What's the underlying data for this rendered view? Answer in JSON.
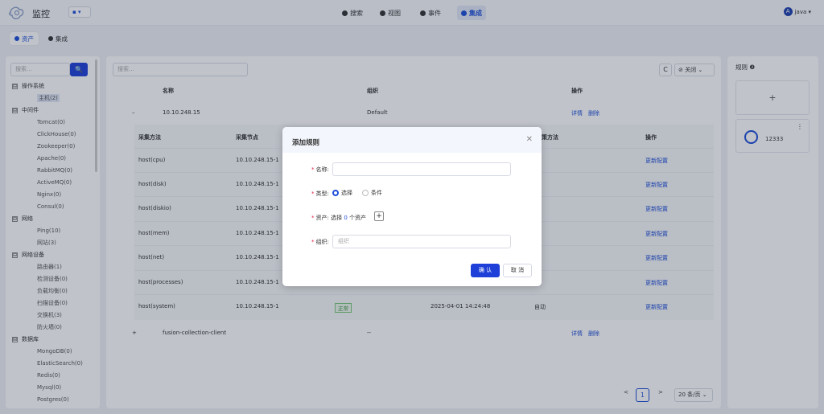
{
  "app": {
    "title": "监控",
    "selector": "▾"
  },
  "nav": [
    {
      "label": "搜索"
    },
    {
      "label": "视图"
    },
    {
      "label": "事件"
    },
    {
      "label": "集成"
    }
  ],
  "user": {
    "avatar": "A",
    "name": "java ▾"
  },
  "subtabs": [
    {
      "label": "资产"
    },
    {
      "label": "集成"
    }
  ],
  "left": {
    "search_placeholder": "搜索...",
    "search_btn": "🔍",
    "tree": [
      {
        "type": "grp",
        "label": "操作系统",
        "box": "⊟"
      },
      {
        "type": "child",
        "label": "主机(2)",
        "selected": true
      },
      {
        "type": "grp",
        "label": "中间件",
        "box": "⊟"
      },
      {
        "type": "child",
        "label": "Tomcat(0)"
      },
      {
        "type": "child",
        "label": "ClickHouse(0)"
      },
      {
        "type": "child",
        "label": "Zookeeper(0)"
      },
      {
        "type": "child",
        "label": "Apache(0)"
      },
      {
        "type": "child",
        "label": "RabbitMQ(0)"
      },
      {
        "type": "child",
        "label": "ActiveMQ(0)"
      },
      {
        "type": "child",
        "label": "Nginx(0)"
      },
      {
        "type": "child",
        "label": "Consul(0)"
      },
      {
        "type": "grp",
        "label": "网络",
        "box": "⊟"
      },
      {
        "type": "child",
        "label": "Ping(10)"
      },
      {
        "type": "child",
        "label": "网站(3)"
      },
      {
        "type": "grp",
        "label": "网络设备",
        "box": "⊟"
      },
      {
        "type": "child",
        "label": "路由器(1)"
      },
      {
        "type": "child",
        "label": "检测设备(0)"
      },
      {
        "type": "child",
        "label": "负载均衡(0)"
      },
      {
        "type": "child",
        "label": "扫描设备(0)"
      },
      {
        "type": "child",
        "label": "交换机(3)"
      },
      {
        "type": "child",
        "label": "防火墙(0)"
      },
      {
        "type": "grp",
        "label": "数据库",
        "box": "⊟"
      },
      {
        "type": "child",
        "label": "MongoDB(0)"
      },
      {
        "type": "child",
        "label": "ElasticSearch(0)"
      },
      {
        "type": "child",
        "label": "Redis(0)"
      },
      {
        "type": "child",
        "label": "Mysql(0)"
      },
      {
        "type": "child",
        "label": "Postgres(0)"
      }
    ]
  },
  "main": {
    "search_placeholder": "搜索...",
    "refresh": "C",
    "close_select": "⊘ 关闭 ⌄",
    "headers": {
      "name": "名称",
      "org": "组织",
      "ops": "操作"
    },
    "rows": [
      {
        "toggle": "–",
        "name": "10.10.248.15",
        "org": "Default",
        "detail": "详情",
        "delete": "删除"
      },
      {
        "toggle": "+",
        "name": "fusion-collection-client",
        "org": "--",
        "detail": "详情",
        "delete": "删除"
      }
    ],
    "inner_headers": {
      "method": "采集方法",
      "node": "采集节点",
      "strategy": "策方法",
      "ops": "操作"
    },
    "inner_rows": [
      {
        "method": "host(cpu)",
        "node": "10.10.248.15-1",
        "mode": "动",
        "op": "更新配置"
      },
      {
        "method": "host(disk)",
        "node": "10.10.248.15-1",
        "mode": "动",
        "op": "更新配置"
      },
      {
        "method": "host(diskio)",
        "node": "10.10.248.15-1",
        "mode": "动",
        "op": "更新配置"
      },
      {
        "method": "host(mem)",
        "node": "10.10.248.15-1",
        "mode": "动",
        "op": "更新配置"
      },
      {
        "method": "host(net)",
        "node": "10.10.248.15-1",
        "mode": "动",
        "op": "更新配置"
      },
      {
        "method": "host(processes)",
        "node": "10.10.248.15-1",
        "mode": "动",
        "op": "更新配置"
      },
      {
        "method": "host(system)",
        "node": "10.10.248.15-1",
        "status": "正常",
        "time": "2025-04-01 14:24:48",
        "mode": "自动",
        "op": "更新配置"
      }
    ],
    "pager": {
      "prev": "<",
      "page": "1",
      "next": ">",
      "size": "20 条/页 ⌄"
    }
  },
  "right": {
    "title": "规则 ❷",
    "add": "+",
    "card_name": "12333",
    "dots": "⋮"
  },
  "modal": {
    "title": "添加规则",
    "close": "✕",
    "name_label": "名称:",
    "type_label": "类型:",
    "radio1": "选择",
    "radio2": "条件",
    "asset_label": "资产:",
    "asset_text_a": "选择",
    "asset_count": "0",
    "asset_text_b": "个资产",
    "plus": "+",
    "org_label": "组织:",
    "org_placeholder": "组织",
    "ok": "确 认",
    "cancel": "取 消",
    "req": "*"
  }
}
